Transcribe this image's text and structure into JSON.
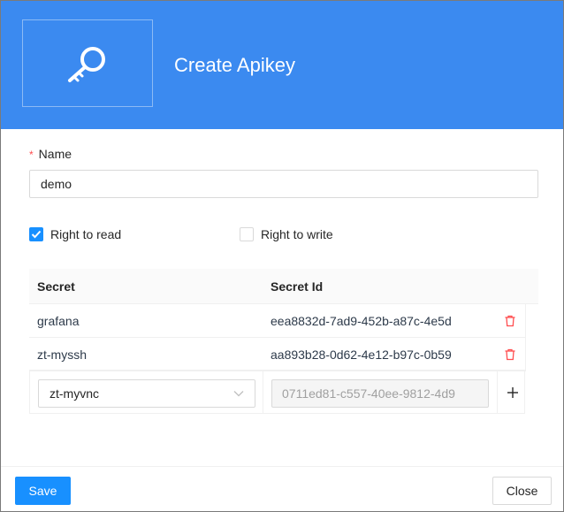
{
  "header": {
    "title": "Create Apikey",
    "icon": "key-icon",
    "color": "#3b8af0"
  },
  "form": {
    "name_label": "Name",
    "name_value": "demo",
    "rights": [
      {
        "label": "Right to read",
        "checked": true
      },
      {
        "label": "Right to write",
        "checked": false
      }
    ]
  },
  "table": {
    "columns": [
      "Secret",
      "Secret Id"
    ],
    "rows": [
      {
        "secret": "grafana",
        "secret_id": "eea8832d-7ad9-452b-a87c-4e5d"
      },
      {
        "secret": "zt-myssh",
        "secret_id": "aa893b28-0d62-4e12-b97c-0b59"
      }
    ],
    "new_row": {
      "secret": "zt-myvnc",
      "secret_id": "0711ed81-c557-40ee-9812-4d9"
    }
  },
  "footer": {
    "save_label": "Save",
    "close_label": "Close",
    "primary_color": "#1890ff"
  }
}
